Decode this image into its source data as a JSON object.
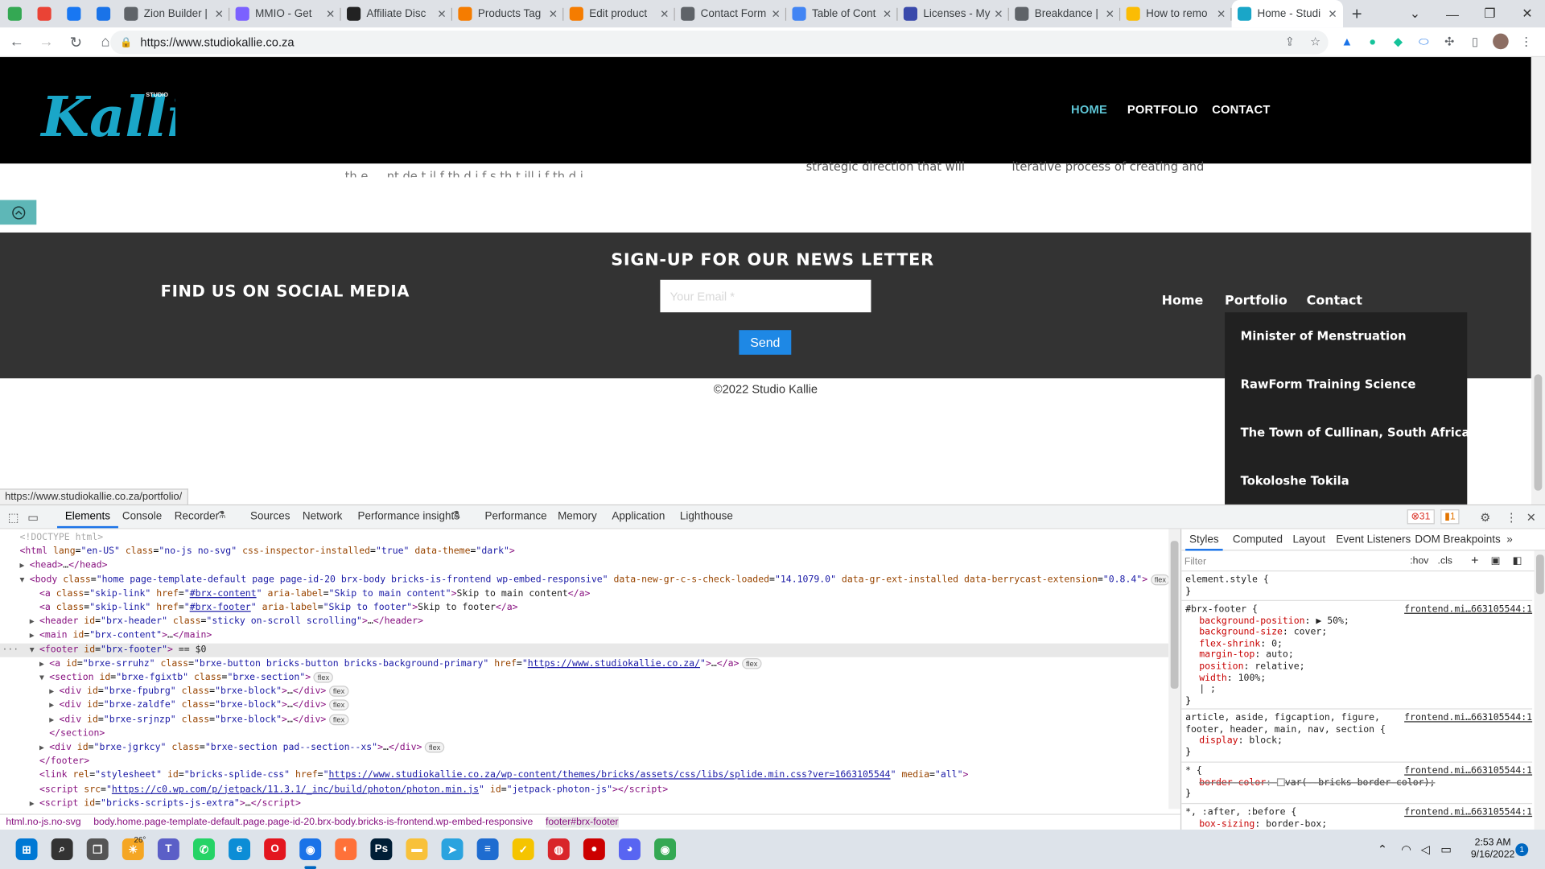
{
  "browser": {
    "tabs": [
      {
        "label": "Zion Builder |",
        "favicon_color": "#5f6368",
        "icon": "globe-icon"
      },
      {
        "label": "MMIO - Get",
        "favicon_color": "#7b61ff",
        "icon": "slack-icon"
      },
      {
        "label": "Affiliate Disc",
        "favicon_color": "#222222",
        "icon": "wp-icon"
      },
      {
        "label": "Products Tag",
        "favicon_color": "#f57c00",
        "icon": "woo-icon"
      },
      {
        "label": "Edit product",
        "favicon_color": "#f57c00",
        "icon": "woo-icon"
      },
      {
        "label": "Contact Form",
        "favicon_color": "#5f6368",
        "icon": "globe-icon"
      },
      {
        "label": "Table of Cont",
        "favicon_color": "#4285f4",
        "icon": "copy-icon"
      },
      {
        "label": "Licenses - My",
        "favicon_color": "#3949ab",
        "icon": "license-icon"
      },
      {
        "label": "Breakdance |",
        "favicon_color": "#5f6368",
        "icon": "globe-icon"
      },
      {
        "label": "How to remo",
        "favicon_color": "#fbbc04",
        "icon": "b-icon"
      },
      {
        "label": "Home - Studi",
        "favicon_color": "#1aa6c8",
        "icon": "kallie-icon",
        "active": true
      }
    ],
    "pinned_icons": [
      "meet-icon",
      "gmail-icon",
      "facebook-icon",
      "docs-icon"
    ],
    "url": "https://www.studiokallie.co.za",
    "status_url": "https://www.studiokallie.co.za/portfolio/"
  },
  "site": {
    "logo_text": "Kallie",
    "logo_small": "STUDIO",
    "nav": [
      "HOME",
      "PORTFOLIO",
      "CONTACT"
    ],
    "peek_texts": [
      "th e ... nt de t il  f th  d  i f    s      th t  ill i f    th   d  i",
      "strategic direction that will",
      "iterative process of creating and"
    ],
    "footer": {
      "newsletter_title": "SIGN-UP FOR OUR NEWS LETTER",
      "social_title": "FIND US ON SOCIAL MEDIA",
      "email_placeholder": "Your Email *",
      "send_label": "Send",
      "nav": [
        "Home",
        "Portfolio",
        "Contact"
      ],
      "dropdown": [
        "Minister of Menstruation",
        "RawForm Training Science",
        "The Town of Cullinan, South Africa",
        "Tokoloshe Tokila"
      ],
      "copyright": "©2022 Studio Kallie"
    },
    "accent_color": "#5ec6d6"
  },
  "devtools": {
    "tabs": [
      "Elements",
      "Console",
      "Recorder",
      "Sources",
      "Network",
      "Performance insights",
      "Performance",
      "Memory",
      "Application",
      "Lighthouse"
    ],
    "errors": "31",
    "warnings": "1",
    "side_tabs": [
      "Styles",
      "Computed",
      "Layout",
      "Event Listeners",
      "DOM Breakpoints"
    ],
    "filter_placeholder": "Filter",
    "hov": ":hov",
    "cls": ".cls",
    "breadcrumbs": [
      "html.no-js.no-svg",
      "body.home.page-template-default.page.page-id-20.brx-body.bricks-is-frontend.wp-embed-responsive",
      "footer#brx-footer"
    ],
    "dom": [
      {
        "indent": 0,
        "html": "<span class='cm'>&lt;!DOCTYPE html&gt;</span>"
      },
      {
        "indent": 0,
        "html": "<span class='tg'>&lt;html</span> <span class='an'>lang</span>=<span class='av'>\"en-US\"</span> <span class='an'>class</span>=<span class='av'>\"no-js no-svg\"</span> <span class='an'>css-inspector-installed</span>=<span class='av'>\"true\"</span> <span class='an'>data-theme</span>=<span class='av'>\"dark\"</span><span class='tg'>&gt;</span>"
      },
      {
        "indent": 1,
        "tri": "▶",
        "html": "<span class='tg'>&lt;head&gt;</span><span class='tx'>…</span><span class='tg'>&lt;/head&gt;</span>"
      },
      {
        "indent": 1,
        "tri": "▼",
        "html": "<span class='tg'>&lt;body</span> <span class='an'>class</span>=<span class='av'>\"home page-template-default page page-id-20 brx-body bricks-is-frontend wp-embed-responsive\"</span> <span class='an'>data-new-gr-c-s-check-loaded</span>=<span class='av'>\"14.1079.0\"</span> <span class='an'>data-gr-ext-installed</span> <span class='an'>data-berrycast-extension</span>=<span class='av'>\"0.8.4\"</span><span class='tg'>&gt;</span><span class='pill'>flex</span>"
      },
      {
        "indent": 2,
        "html": "<span class='tg'>&lt;a</span> <span class='an'>class</span>=<span class='av'>\"skip-link\"</span> <span class='an'>href</span>=<span class='av'>\"<span class='lk'>#brx-content</span>\"</span> <span class='an'>aria-label</span>=<span class='av'>\"Skip to main content\"</span><span class='tg'>&gt;</span><span class='tx'>Skip to main content</span><span class='tg'>&lt;/a&gt;</span>"
      },
      {
        "indent": 2,
        "html": "<span class='tg'>&lt;a</span> <span class='an'>class</span>=<span class='av'>\"skip-link\"</span> <span class='an'>href</span>=<span class='av'>\"<span class='lk'>#brx-footer</span>\"</span> <span class='an'>aria-label</span>=<span class='av'>\"Skip to footer\"</span><span class='tg'>&gt;</span><span class='tx'>Skip to footer</span><span class='tg'>&lt;/a&gt;</span>"
      },
      {
        "indent": 2,
        "tri": "▶",
        "html": "<span class='tg'>&lt;header</span> <span class='an'>id</span>=<span class='av'>\"brx-header\"</span> <span class='an'>class</span>=<span class='av'>\"sticky on-scroll scrolling\"</span><span class='tg'>&gt;</span><span class='tx'>…</span><span class='tg'>&lt;/header&gt;</span>"
      },
      {
        "indent": 2,
        "tri": "▶",
        "html": "<span class='tg'>&lt;main</span> <span class='an'>id</span>=<span class='av'>\"brx-content\"</span><span class='tg'>&gt;</span><span class='tx'>…</span><span class='tg'>&lt;/main&gt;</span>"
      },
      {
        "indent": 2,
        "tri": "▼",
        "sel": true,
        "html": "<span class='tg'>&lt;footer</span> <span class='an'>id</span>=<span class='av'>\"brx-footer\"</span><span class='tg'>&gt;</span> <span class='tx'>== $0</span>"
      },
      {
        "indent": 3,
        "tri": "▶",
        "html": "<span class='tg'>&lt;a</span> <span class='an'>id</span>=<span class='av'>\"brxe-srruhz\"</span> <span class='an'>class</span>=<span class='av'>\"brxe-button bricks-button bricks-background-primary\"</span> <span class='an'>href</span>=<span class='av'>\"<span class='lk'>https://www.studiokallie.co.za/</span>\"</span><span class='tg'>&gt;</span><span class='tx'>…</span><span class='tg'>&lt;/a&gt;</span><span class='pill'>flex</span>"
      },
      {
        "indent": 3,
        "tri": "▼",
        "html": "<span class='tg'>&lt;section</span> <span class='an'>id</span>=<span class='av'>\"brxe-fgixtb\"</span> <span class='an'>class</span>=<span class='av'>\"brxe-section\"</span><span class='tg'>&gt;</span><span class='pill'>flex</span>"
      },
      {
        "indent": 4,
        "tri": "▶",
        "html": "<span class='tg'>&lt;div</span> <span class='an'>id</span>=<span class='av'>\"brxe-fpubrg\"</span> <span class='an'>class</span>=<span class='av'>\"brxe-block\"</span><span class='tg'>&gt;</span><span class='tx'>…</span><span class='tg'>&lt;/div&gt;</span><span class='pill'>flex</span>"
      },
      {
        "indent": 4,
        "tri": "▶",
        "html": "<span class='tg'>&lt;div</span> <span class='an'>id</span>=<span class='av'>\"brxe-zaldfe\"</span> <span class='an'>class</span>=<span class='av'>\"brxe-block\"</span><span class='tg'>&gt;</span><span class='tx'>…</span><span class='tg'>&lt;/div&gt;</span><span class='pill'>flex</span>"
      },
      {
        "indent": 4,
        "tri": "▶",
        "html": "<span class='tg'>&lt;div</span> <span class='an'>id</span>=<span class='av'>\"brxe-srjnzp\"</span> <span class='an'>class</span>=<span class='av'>\"brxe-block\"</span><span class='tg'>&gt;</span><span class='tx'>…</span><span class='tg'>&lt;/div&gt;</span><span class='pill'>flex</span>"
      },
      {
        "indent": 3,
        "html": "<span class='tg'>&lt;/section&gt;</span>"
      },
      {
        "indent": 3,
        "tri": "▶",
        "html": "<span class='tg'>&lt;div</span> <span class='an'>id</span>=<span class='av'>\"brxe-jgrkcy\"</span> <span class='an'>class</span>=<span class='av'>\"brxe-section pad--section--xs\"</span><span class='tg'>&gt;</span><span class='tx'>…</span><span class='tg'>&lt;/div&gt;</span><span class='pill'>flex</span>"
      },
      {
        "indent": 2,
        "html": "<span class='tg'>&lt;/footer&gt;</span>"
      },
      {
        "indent": 2,
        "html": "<span class='tg'>&lt;link</span> <span class='an'>rel</span>=<span class='av'>\"stylesheet\"</span> <span class='an'>id</span>=<span class='av'>\"bricks-splide-css\"</span> <span class='an'>href</span>=<span class='av'>\"<span class='lk'>https://www.studiokallie.co.za/wp-content/themes/bricks/assets/css/libs/splide.min.css?ver=1663105544</span>\"</span> <span class='an'>media</span>=<span class='av'>\"all\"</span><span class='tg'>&gt;</span>"
      },
      {
        "indent": 2,
        "html": "<span class='tg'>&lt;script</span> <span class='an'>src</span>=<span class='av'>\"<span class='lk'>https://c0.wp.com/p/jetpack/11.3.1/_inc/build/photon/photon.min.js</span>\"</span> <span class='an'>id</span>=<span class='av'>\"jetpack-photon-js\"</span><span class='tg'>&gt;&lt;/script&gt;</span>"
      },
      {
        "indent": 2,
        "tri": "▶",
        "html": "<span class='tg'>&lt;script</span> <span class='an'>id</span>=<span class='av'>\"bricks-scripts-js-extra\"</span><span class='tg'>&gt;</span><span class='tx'>…</span><span class='tg'>&lt;/script&gt;</span>"
      }
    ],
    "styles": {
      "element_style": "element.style {",
      "footer_selector": "#brx-footer {",
      "footer_source": "frontend.mi…663105544:1",
      "footer_props": [
        [
          "background-position",
          "▶ 50%;"
        ],
        [
          "background-size",
          "cover;"
        ],
        [
          "flex-shrink",
          "0;"
        ],
        [
          "margin-top",
          "auto;"
        ],
        [
          "position",
          "relative;"
        ],
        [
          "width",
          "100%;"
        ]
      ],
      "block_selector": "article, aside, figcaption, figure,",
      "block_selector2": "footer, header, main, nav, section {",
      "block_source": "frontend.mi…663105544:1",
      "block_prop": [
        "display",
        "block;"
      ],
      "star_selector": "* {",
      "star_source": "frontend.mi…663105544:1",
      "star_prop": [
        "border-color",
        "var(--bricks-border-color);"
      ],
      "pseudo_selector": "*, :after, :before {",
      "pseudo_source": "frontend.mi…663105544:1",
      "pseudo_prop": [
        "box-sizing",
        "border-box;"
      ],
      "close_brace": "}"
    }
  },
  "taskbar": {
    "weather": "26°",
    "time": "2:53 AM",
    "date": "9/16/2022",
    "notifications": "1",
    "apps": [
      {
        "name": "start-icon",
        "color": "#0078d4"
      },
      {
        "name": "search-icon",
        "color": "#333333"
      },
      {
        "name": "task-view-icon",
        "color": "#555555"
      },
      {
        "name": "weather-icon",
        "color": "#f5a623"
      },
      {
        "name": "teams-icon",
        "color": "#5b5fc7"
      },
      {
        "name": "whatsapp-icon",
        "color": "#25d366"
      },
      {
        "name": "edge-icon",
        "color": "#0c8dd6"
      },
      {
        "name": "opera-icon",
        "color": "#e3161f"
      },
      {
        "name": "chrome-icon",
        "color": "#1a73e8"
      },
      {
        "name": "firefox-icon",
        "color": "#ff7139"
      },
      {
        "name": "photoshop-icon",
        "color": "#001e36"
      },
      {
        "name": "explorer-icon",
        "color": "#f8c13a"
      },
      {
        "name": "telegram-icon",
        "color": "#2aa3df"
      },
      {
        "name": "notepad-icon",
        "color": "#1e6cd0"
      },
      {
        "name": "norton-icon",
        "color": "#f5c400"
      },
      {
        "name": "app-red-icon",
        "color": "#d9252a"
      },
      {
        "name": "record-icon",
        "color": "#cc0000"
      },
      {
        "name": "discord-icon",
        "color": "#5865f2"
      },
      {
        "name": "chrome-beta-icon",
        "color": "#34a853"
      }
    ]
  }
}
